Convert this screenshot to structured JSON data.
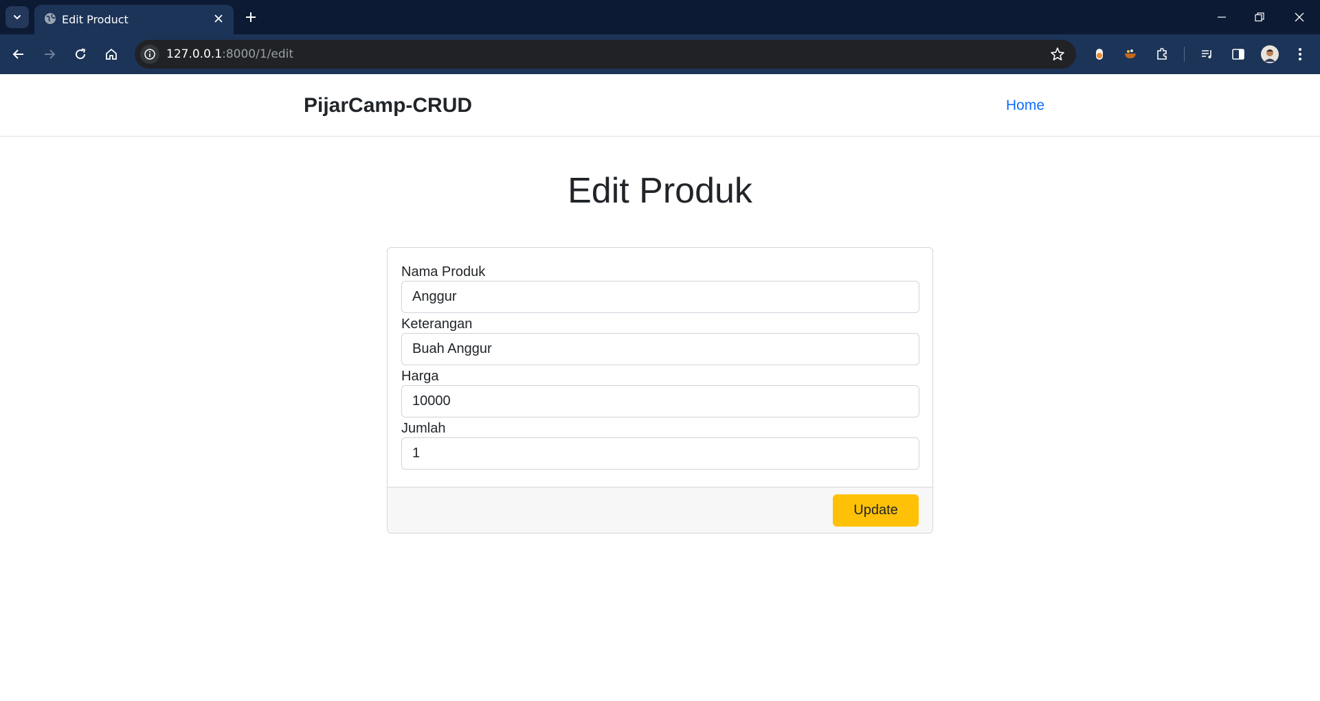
{
  "browser": {
    "tab_title": "Edit Product",
    "url_host": "127.0.0.1",
    "url_rest": ":8000/1/edit"
  },
  "site": {
    "brand": "PijarCamp-CRUD",
    "nav_home": "Home"
  },
  "main": {
    "heading": "Edit Produk",
    "fields": [
      {
        "label": "Nama Produk",
        "value": "Anggur"
      },
      {
        "label": "Keterangan",
        "value": "Buah Anggur"
      },
      {
        "label": "Harga",
        "value": "10000"
      },
      {
        "label": "Jumlah",
        "value": "1"
      }
    ],
    "submit_label": "Update"
  },
  "colors": {
    "chrome_dark": "#0c1a33",
    "chrome_toolbar": "#1c3458",
    "link": "#0d6efd",
    "button_warning": "#ffc107"
  }
}
